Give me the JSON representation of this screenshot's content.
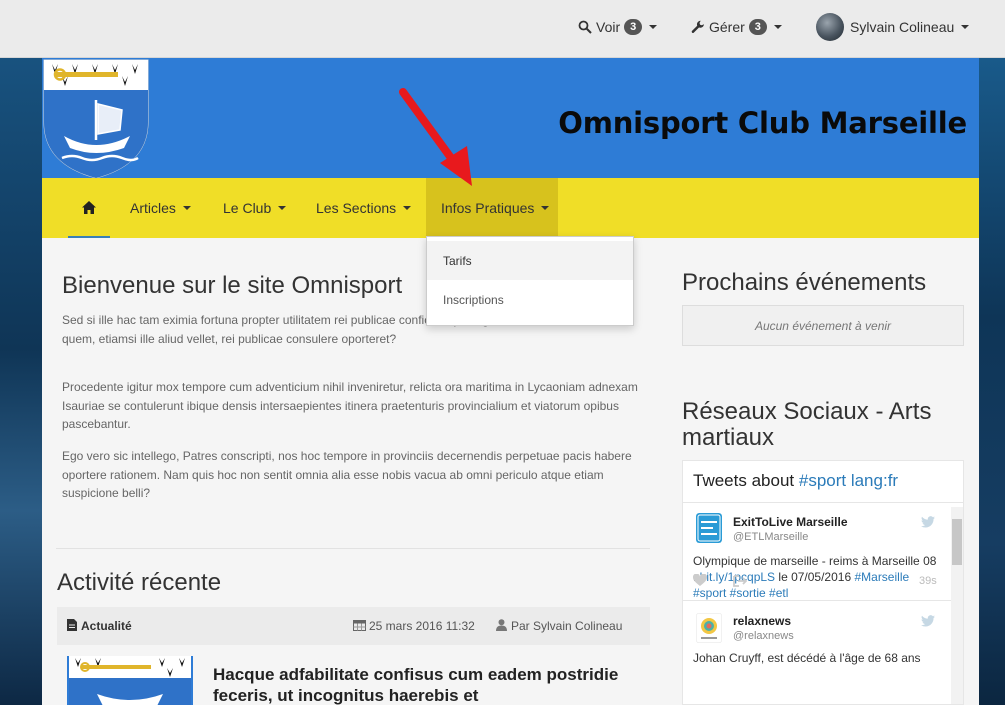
{
  "admin_bar": {
    "voir_label": "Voir",
    "voir_count": "3",
    "gerer_label": "Gérer",
    "gerer_count": "3",
    "user_name": "Sylvain Colineau"
  },
  "site": {
    "title": "Omnisport Club Marseille"
  },
  "nav": {
    "articles": "Articles",
    "club": "Le Club",
    "sections": "Les Sections",
    "infos": "Infos Pratiques",
    "dropdown": [
      "Tarifs",
      "Inscriptions"
    ]
  },
  "main": {
    "welcome_title": "Bienvenue sur le site Omnisport",
    "paragraphs": [
      "Sed si ille hac tam eximia fortuna propter utilitatem rei publicae",
      "conficiat, quid ego, senator, facere debeo, quem, etiamsi ille aliud vellet, rei publicae consulere oporteret?",
      "Procedente igitur mox tempore cum adventicium nihil inveniretur, relicta ora maritima in Lycaoniam adnexam Isauriae se contulerunt ibique densis intersaepientes itinera praetenturis provincialium et viatorum opibus pascebantur.",
      "Ego vero sic intellego, Patres conscripti, nos hoc tempore in provinciis decernendis perpetuae pacis habere oportere rationem. Nam quis hoc non sentit omnia alia esse nobis vacua ab omni periculo atque etiam suspicione belli?"
    ],
    "activity_title": "Activité récente",
    "activity_category": "Actualité",
    "activity_date": "25 mars 2016 11:32",
    "activity_author": "Par Sylvain Colineau",
    "article_title": "Hacque adfabilitate confisus cum eadem postridie feceris, ut incognitus haerebis et"
  },
  "sidebar": {
    "events_title": "Prochains événements",
    "events_empty": "Aucun événement à venir",
    "social_title": "Réseaux Sociaux - Arts martiaux",
    "tweets_header": "Tweets about",
    "tweets_query": "#sport lang:fr",
    "tweets": [
      {
        "name": "ExitToLive Marseille",
        "handle": "@ETLMarseille",
        "text_start": "Olympique de marseille - reims à Marseille 08 : ",
        "link": "bit.ly/1pcqpLS",
        "text_mid": " le 07/05/2016 ",
        "tags": "#Marseille #sport #sortie #etl",
        "time": "39s"
      },
      {
        "name": "relaxnews",
        "handle": "@relaxnews",
        "text_start": "Johan Cruyff, est décédé à l'âge de 68 ans"
      }
    ]
  },
  "colors": {
    "header_blue": "#2e7cd6",
    "nav_yellow": "#f0de27",
    "nav_active": "#d7c21d",
    "annotation_arrow": "#e8191d"
  }
}
